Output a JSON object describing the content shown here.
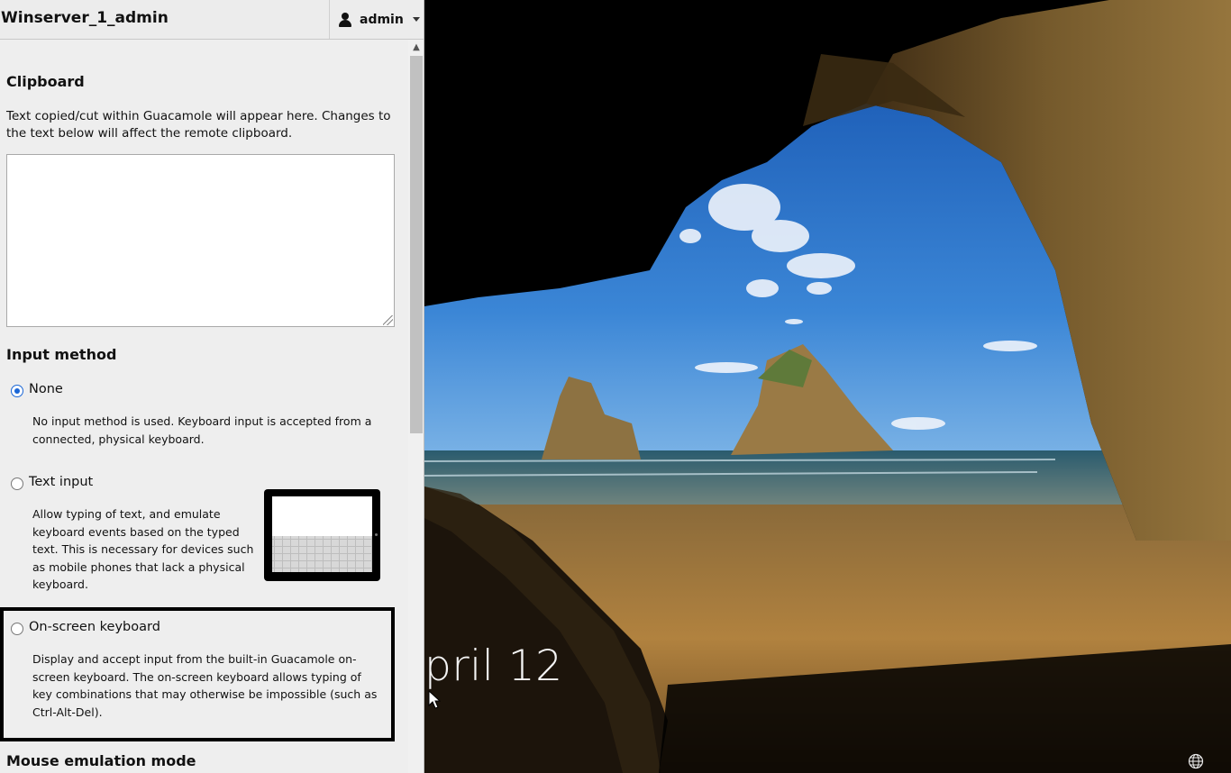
{
  "header": {
    "connection_name": "Winserver_1_admin",
    "user_menu": {
      "username": "admin",
      "icon": "user-icon"
    }
  },
  "clipboard": {
    "title": "Clipboard",
    "description": "Text copied/cut within Guacamole will appear here. Changes to the text below will affect the remote clipboard.",
    "value": ""
  },
  "input_method": {
    "title": "Input method",
    "selected": "None",
    "options": [
      {
        "label": "None",
        "description": "No input method is used. Keyboard input is accepted from a connected, physical keyboard."
      },
      {
        "label": "Text input",
        "description": "Allow typing of text, and emulate keyboard events based on the typed text. This is necessary for devices such as mobile phones that lack a physical keyboard."
      },
      {
        "label": "On-screen keyboard",
        "description": "Display and accept input from the built-in Guacamole on-screen keyboard. The on-screen keyboard allows typing of key combinations that may otherwise be impossible (such as Ctrl-Alt-Del)."
      }
    ]
  },
  "mouse_emulation": {
    "title": "Mouse emulation mode"
  },
  "remote_desktop": {
    "lock_screen_date_fragment": "pril 12",
    "tray_icon": "globe-icon"
  },
  "colors": {
    "menu_background": "#eeeeee",
    "radio_selected": "#1a66d6",
    "lock_text": "#f4f4f4"
  }
}
